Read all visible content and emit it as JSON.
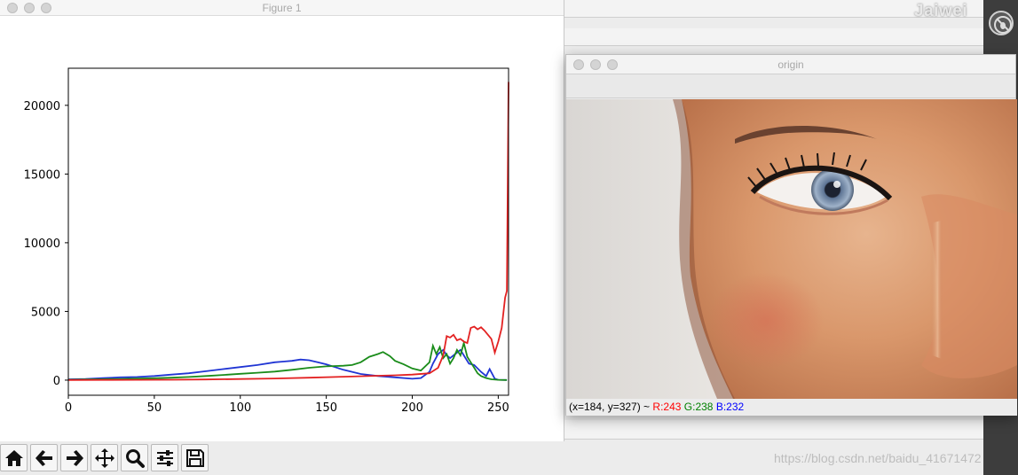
{
  "figure_window": {
    "title": "Figure 1",
    "toolbar": [
      {
        "name": "home-button",
        "icon": "home-icon"
      },
      {
        "name": "back-button",
        "icon": "arrow-left-icon"
      },
      {
        "name": "forward-button",
        "icon": "arrow-right-icon"
      },
      {
        "name": "pan-button",
        "icon": "move-icon"
      },
      {
        "name": "zoom-button",
        "icon": "magnifier-icon"
      },
      {
        "name": "configure-subplots-button",
        "icon": "sliders-icon"
      },
      {
        "name": "save-button",
        "icon": "floppy-disk-icon"
      }
    ]
  },
  "chart_data": {
    "type": "line",
    "title": "",
    "xlabel": "",
    "ylabel": "",
    "xlim": [
      0,
      256
    ],
    "ylim": [
      -1100,
      22700
    ],
    "xticks": [
      0,
      50,
      100,
      150,
      200,
      250
    ],
    "yticks": [
      0,
      5000,
      10000,
      15000,
      20000
    ],
    "grid": false,
    "series": [
      {
        "color": "#2035d4",
        "x": [
          0,
          10,
          20,
          30,
          40,
          50,
          60,
          70,
          80,
          90,
          100,
          110,
          120,
          125,
          130,
          135,
          140,
          145,
          150,
          155,
          160,
          165,
          170,
          180,
          190,
          200,
          205,
          210,
          212,
          215,
          218,
          220,
          222,
          225,
          228,
          230,
          233,
          236,
          240,
          243,
          245,
          248,
          250,
          255
        ],
        "values": [
          60,
          90,
          150,
          200,
          230,
          300,
          400,
          500,
          650,
          800,
          950,
          1100,
          1300,
          1350,
          1400,
          1500,
          1450,
          1300,
          1150,
          950,
          750,
          600,
          450,
          300,
          200,
          100,
          150,
          600,
          1200,
          1900,
          2200,
          1800,
          1600,
          1900,
          2200,
          1800,
          1200,
          1100,
          600,
          300,
          800,
          100,
          20,
          10
        ]
      },
      {
        "color": "#1a8c1a",
        "x": [
          0,
          10,
          20,
          30,
          40,
          50,
          60,
          70,
          80,
          90,
          100,
          110,
          120,
          130,
          140,
          150,
          160,
          165,
          170,
          175,
          180,
          183,
          187,
          190,
          195,
          200,
          205,
          210,
          212,
          214,
          216,
          218,
          220,
          222,
          224,
          226,
          228,
          230,
          232,
          234,
          236,
          238,
          240,
          243,
          246,
          250,
          255
        ],
        "values": [
          30,
          50,
          70,
          90,
          110,
          140,
          180,
          230,
          300,
          380,
          460,
          540,
          620,
          750,
          900,
          1000,
          1050,
          1100,
          1300,
          1700,
          1900,
          2050,
          1750,
          1400,
          1150,
          850,
          700,
          1300,
          2500,
          1900,
          2400,
          1600,
          1900,
          1200,
          1600,
          2200,
          1800,
          2700,
          1700,
          1300,
          900,
          500,
          300,
          150,
          60,
          20,
          10
        ]
      },
      {
        "color": "#e32222",
        "x": [
          0,
          20,
          40,
          60,
          80,
          100,
          120,
          140,
          160,
          180,
          190,
          200,
          210,
          215,
          218,
          220,
          222,
          224,
          226,
          228,
          230,
          232,
          234,
          236,
          238,
          240,
          242,
          244,
          246,
          247,
          248,
          250,
          252,
          254,
          255,
          256
        ],
        "values": [
          10,
          15,
          20,
          30,
          50,
          80,
          120,
          180,
          250,
          320,
          350,
          400,
          500,
          900,
          1800,
          3200,
          3100,
          3300,
          2900,
          3000,
          2800,
          2700,
          3800,
          3900,
          3700,
          3850,
          3600,
          3300,
          3000,
          2500,
          2000,
          2800,
          3800,
          6000,
          6500,
          21700
        ]
      }
    ]
  },
  "origin_window": {
    "title": "origin",
    "status": {
      "coords": "(x=184, y=327) ~",
      "r": "R:243",
      "g": "G:238",
      "b": "B:232"
    }
  },
  "desktop": {
    "top_watermark": "Jaiwei",
    "bottom_watermark": "https://blog.csdn.net/baidu_41671472"
  }
}
